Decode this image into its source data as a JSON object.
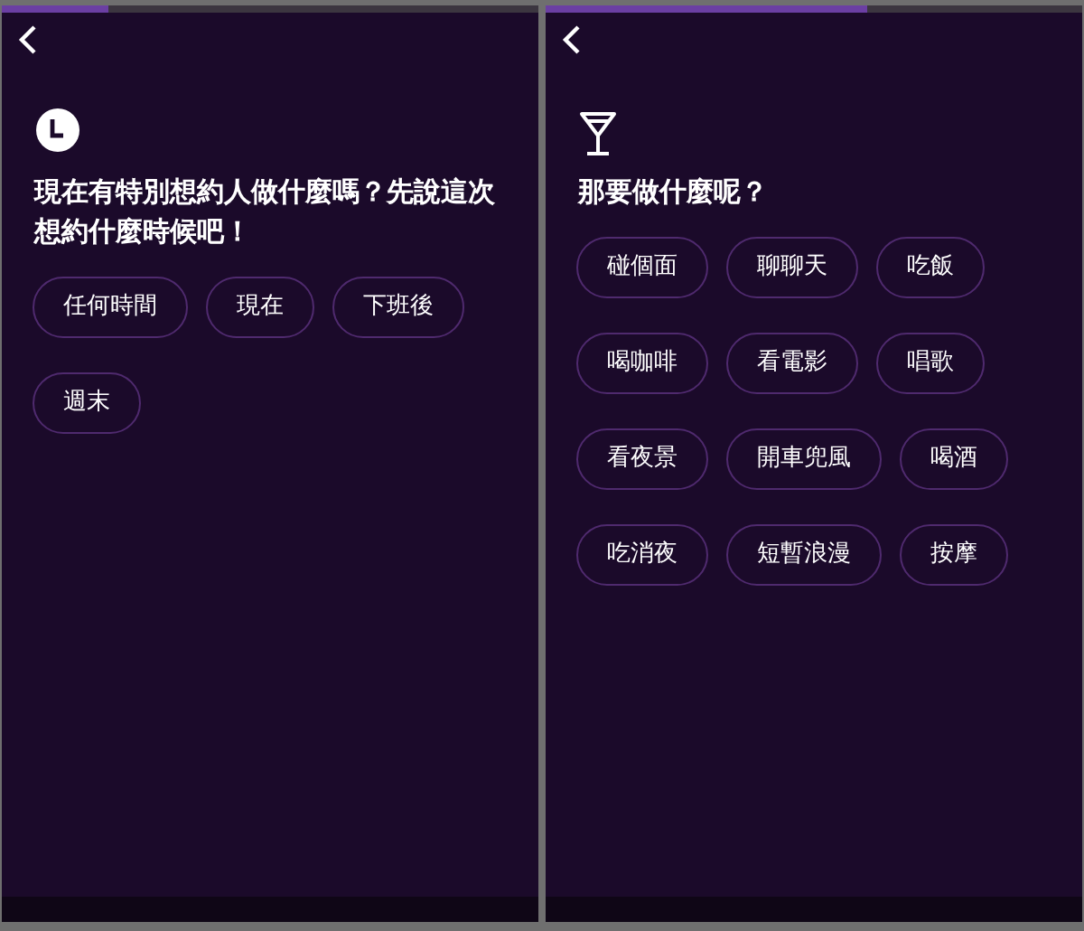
{
  "screens": [
    {
      "progress": {
        "level": 0.2
      },
      "icon": {
        "kind": "clock"
      },
      "question": "現在有特別想約人做什麼嗎？先說這次想約什麼時候吧！",
      "options": [
        "任何時間",
        "現在",
        "下班後",
        "週末"
      ]
    },
    {
      "progress": {
        "level": 0.6
      },
      "icon": {
        "kind": "cocktail"
      },
      "question": "那要做什麼呢？",
      "options": [
        "碰個面",
        "聊聊天",
        "吃飯",
        "喝咖啡",
        "看電影",
        "唱歌",
        "看夜景",
        "開車兜風",
        "喝酒",
        "吃消夜",
        "短暫浪漫",
        "按摩"
      ]
    }
  ]
}
